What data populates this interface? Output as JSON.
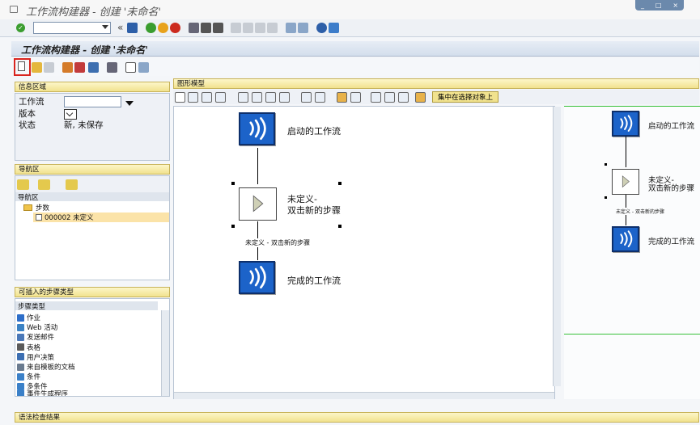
{
  "app_title": "工作流构建器 - 创建 '未命名'",
  "window_controls": {
    "minimize": "_",
    "maximize": "□",
    "close": "×"
  },
  "command_field": {
    "value": ""
  },
  "screen_title": "工作流构建器 - 创建 '未命名'",
  "info_panel": {
    "header": "信息区域",
    "workflow_label": "工作流",
    "workflow_value": "",
    "version_label": "版本",
    "status_label": "状态",
    "status_value": "新, 未保存"
  },
  "nav_panel": {
    "header": "导航区",
    "tree_header": "导航区",
    "tree_root": "步数",
    "tree_item": "000002 未定义"
  },
  "step_types_panel": {
    "header": "可插入的步骤类型",
    "column_header": "步骤类型",
    "items": [
      "作业",
      "Web 活动",
      "发送邮件",
      "表格",
      "用户决策",
      "来自模板的文档",
      "条件",
      "多条件",
      "事件生成程序"
    ]
  },
  "graph_panel": {
    "header": "图形模型",
    "focus_button": "集中在选择对象上",
    "nodes": {
      "start": "启动的工作流",
      "undefined_line1": "未定义-",
      "undefined_line2": "双击新的步骤",
      "edge_label": "未定义 - 双击新的步骤",
      "end": "完成的工作流"
    }
  },
  "preview_panel": {
    "start": "启动的工作流",
    "undefined_line1": "未定义-",
    "undefined_line2": "双击新的步骤",
    "edge_label": "未定义 - 双击新的步骤",
    "end": "完成的工作流"
  },
  "syntax_panel": {
    "header": "语法检查结果"
  },
  "colors": {
    "accent_red": "#d9241e",
    "node_blue": "#1c63c9",
    "panel_header": "#f1e28e"
  }
}
